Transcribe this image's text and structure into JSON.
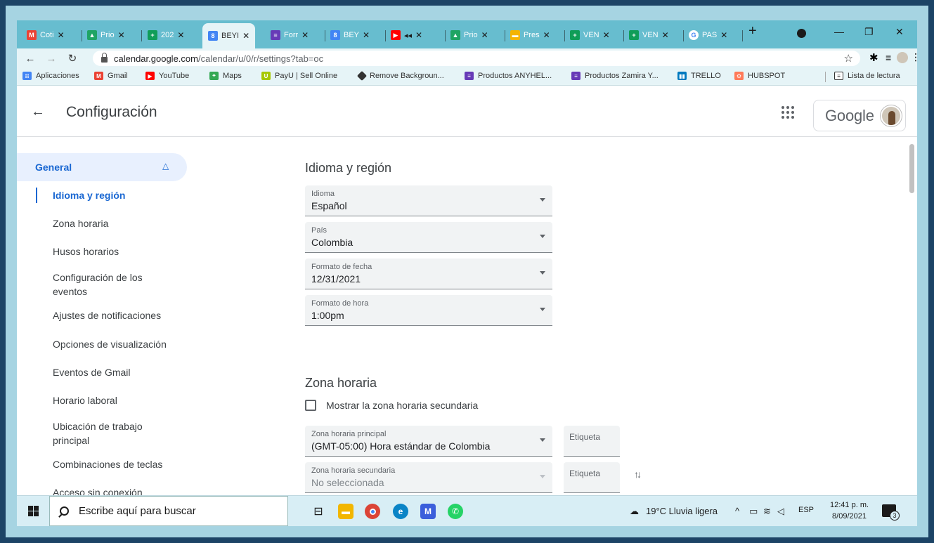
{
  "tabs": [
    {
      "label": "Coti",
      "icon": "gmail-icon",
      "color": "#ea4335"
    },
    {
      "label": "Prio",
      "icon": "drive-icon",
      "color": "#1fa463"
    },
    {
      "label": "202",
      "icon": "sheets-icon",
      "color": "#0f9d58"
    },
    {
      "label": "BEYI",
      "icon": "calendar-icon",
      "color": "#4285f4",
      "active": true
    },
    {
      "label": "Forr",
      "icon": "forms-icon",
      "color": "#673ab7"
    },
    {
      "label": "BEY",
      "icon": "calendar-icon",
      "color": "#4285f4"
    },
    {
      "label": "◂◂",
      "icon": "youtube-icon",
      "color": "#ff0000"
    },
    {
      "label": "Prio",
      "icon": "drive-icon",
      "color": "#1fa463"
    },
    {
      "label": "Pres",
      "icon": "slides-icon",
      "color": "#f4b400"
    },
    {
      "label": "VEN",
      "icon": "sheets-icon",
      "color": "#0f9d58"
    },
    {
      "label": "VEN",
      "icon": "sheets-icon",
      "color": "#0f9d58"
    },
    {
      "label": "PAS",
      "icon": "google-icon",
      "color": "#4285f4"
    }
  ],
  "toolbar": {
    "url_host": "calendar.google.com",
    "url_path": "/calendar/u/0/r/settings?tab=oc"
  },
  "bookmarks": [
    {
      "label": "Aplicaciones",
      "color": "#4285f4"
    },
    {
      "label": "Gmail",
      "color": "#ea4335"
    },
    {
      "label": "YouTube",
      "color": "#ff0000"
    },
    {
      "label": "Maps",
      "color": "#34a853"
    },
    {
      "label": "PayU | Sell Online",
      "color": "#a6c800"
    },
    {
      "label": "Remove Backgroun...",
      "color": "#333333"
    },
    {
      "label": "Productos ANYHEL...",
      "color": "#673ab7"
    },
    {
      "label": "Productos Zamira Y...",
      "color": "#673ab7"
    },
    {
      "label": "TRELLO",
      "color": "#0079bf"
    },
    {
      "label": "HUBSPOT",
      "color": "#ff7a59"
    },
    {
      "label": "Lista de lectura",
      "color": "#333333"
    }
  ],
  "header": {
    "title": "Configuración",
    "google_label": "Google"
  },
  "sidebar": {
    "section": "General",
    "items": [
      "Idioma y región",
      "Zona horaria",
      "Husos horarios",
      "Configuración de los eventos",
      "Ajustes de notificaciones",
      "Opciones de visualización",
      "Eventos de Gmail",
      "Horario laboral",
      "Ubicación de trabajo principal",
      "Combinaciones de teclas",
      "Acceso sin conexión"
    ]
  },
  "lang_region": {
    "heading": "Idioma y región",
    "fields": [
      {
        "label": "Idioma",
        "value": "Español"
      },
      {
        "label": "País",
        "value": "Colombia"
      },
      {
        "label": "Formato de fecha",
        "value": "12/31/2021"
      },
      {
        "label": "Formato de hora",
        "value": "1:00pm"
      }
    ]
  },
  "timezone": {
    "heading": "Zona horaria",
    "secondary_checkbox": "Mostrar la zona horaria secundaria",
    "primary_label": "Zona horaria principal",
    "primary_value": "(GMT-05:00) Hora estándar de Colombia",
    "secondary_label": "Zona horaria secundaria",
    "secondary_value": "No seleccionada",
    "tag_label": "Etiqueta"
  },
  "taskbar": {
    "search_placeholder": "Escribe aquí para buscar",
    "weather": "19°C  Lluvia ligera",
    "lang": "ESP",
    "time": "12:41 p. m.",
    "date": "8/09/2021",
    "notifications": "3"
  }
}
